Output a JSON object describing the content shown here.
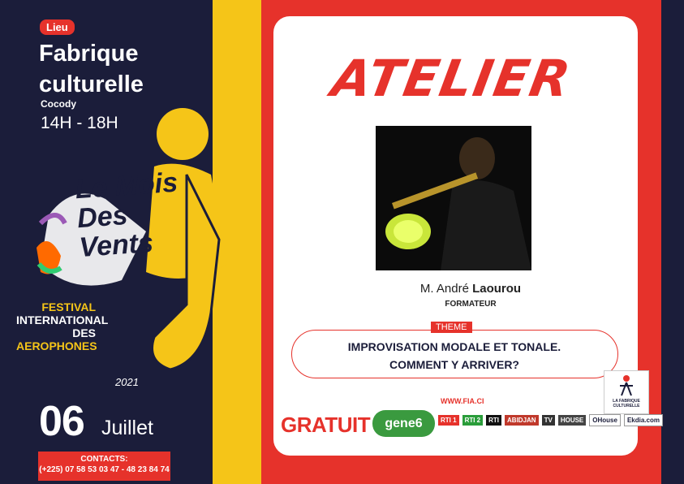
{
  "venue": {
    "badge": "Lieu",
    "name": "Fabrique culturelle",
    "district": "Cocody",
    "hours": "14H - 18H"
  },
  "festival": {
    "line1": "FESTIVAL",
    "line2": "INTERNATIONAL",
    "line3_prefix": "DES ",
    "line3_highlight": "AEROPHONES",
    "logo_text": "Le Mois Des Vents",
    "year": "2021"
  },
  "date": {
    "day": "06",
    "month": "Juillet"
  },
  "contacts": {
    "label": "CONTACTS:",
    "numbers": "(+225) 07 58 53 03 47 - 48 23 84 74"
  },
  "event": {
    "title": "ATELIER",
    "person_prefix": "M. André ",
    "person_last": "Laourou",
    "role": "FORMATEUR",
    "theme_label": "THEME",
    "theme_line1": "IMPROVISATION MODALE ET TONALE.",
    "theme_line2": "COMMENT Y ARRIVER?",
    "website": "WWW.FIA.CI",
    "price": "GRATUIT"
  },
  "sponsors": {
    "main": "gene6",
    "others": [
      "RTI 1",
      "RTI 2",
      "RTI",
      "ABIDJAN",
      "TV",
      "HOUSE",
      "OHouse",
      "Ekdia.com"
    ],
    "fabrique_logo": "LA FABRIQUE CULTURELLE"
  },
  "colors": {
    "navy": "#1b1d3a",
    "red": "#e6322b",
    "yellow": "#f5c518",
    "white": "#ffffff"
  }
}
